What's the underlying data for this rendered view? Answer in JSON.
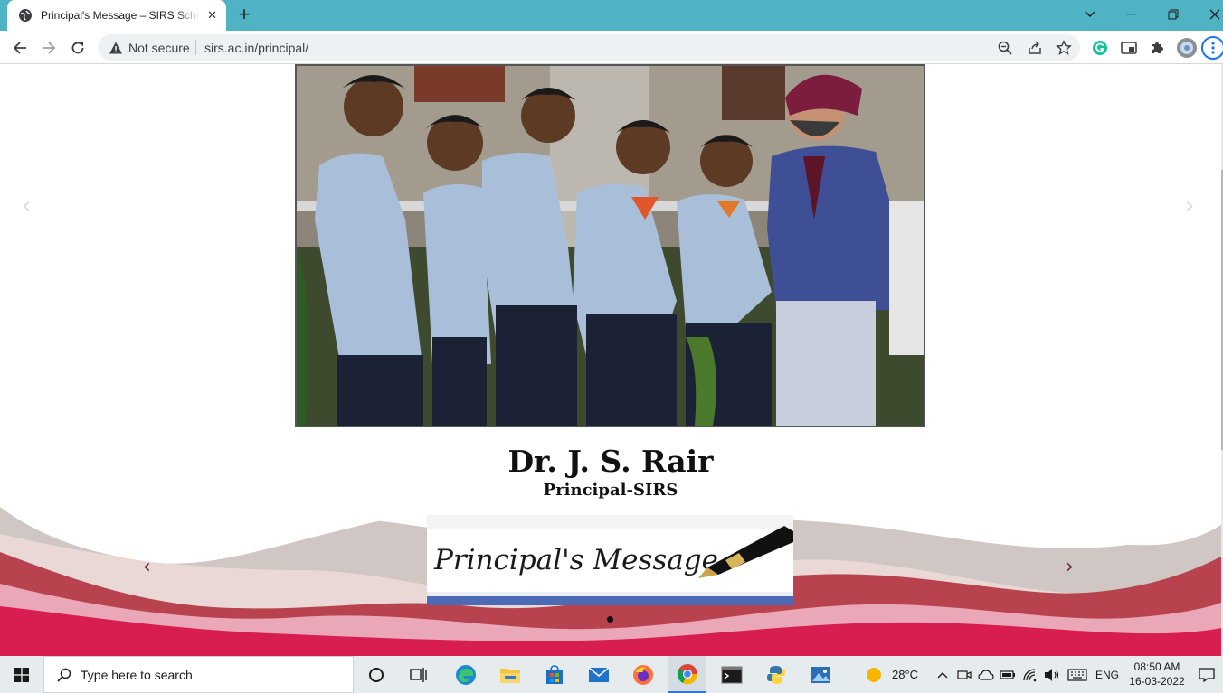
{
  "browser": {
    "tab_title": "Principal's Message – SIRS School",
    "tab_close": "✕",
    "new_tab": "+",
    "security_label": "Not secure",
    "url": "sirs.ac.in/principal/"
  },
  "page": {
    "principal_name": "Dr. J. S. Rair",
    "principal_title": "Principal-SIRS",
    "banner_text": "Principal's Message",
    "colors": {
      "wave_crimson": "#d81e50",
      "wave_pink": "#e9a7b8",
      "wave_grey": "#cfc4c0",
      "accent_blue": "#4d6bb5"
    }
  },
  "taskbar": {
    "search_placeholder": "Type here to search",
    "weather": "28°C",
    "language": "ENG",
    "time": "08:50 AM",
    "date": "16-03-2022"
  }
}
